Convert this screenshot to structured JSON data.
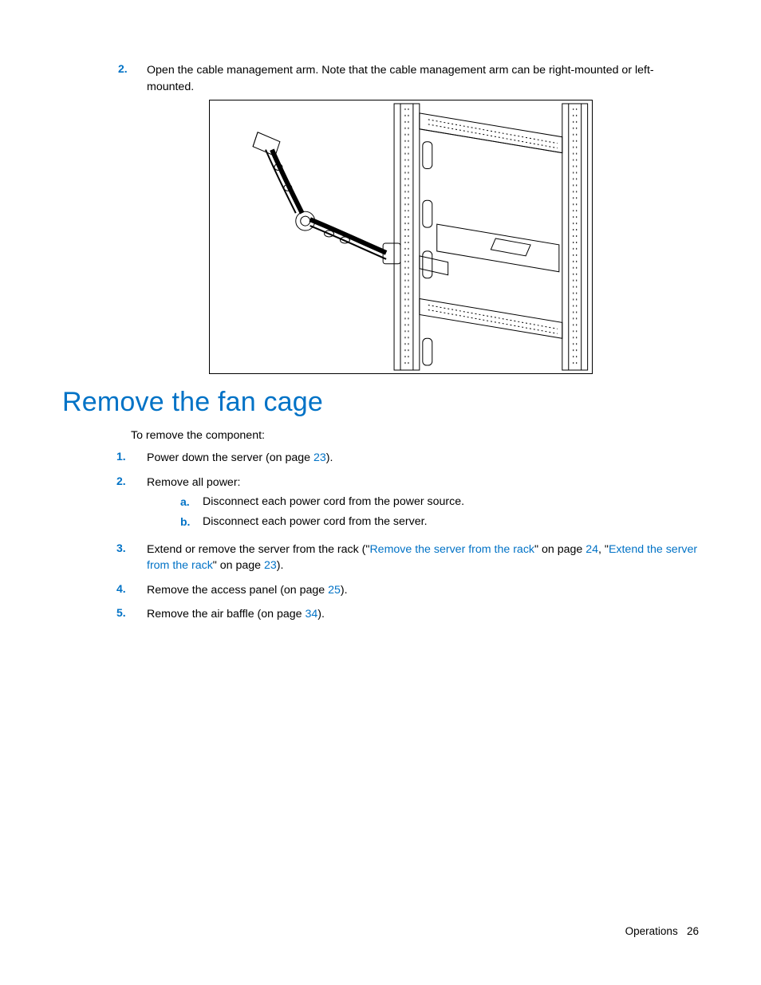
{
  "topStep": {
    "num": "2.",
    "text": "Open the cable management arm. Note that the cable management arm can be right-mounted or left-mounted."
  },
  "section": {
    "heading": "Remove the fan cage",
    "intro": "To remove the component:",
    "steps": [
      {
        "num": "1.",
        "pre": "Power down the server (on page ",
        "link1": "23",
        "post": ")."
      },
      {
        "num": "2.",
        "text": "Remove all power:",
        "sub": [
          {
            "letter": "a.",
            "text": "Disconnect each power cord from the power source."
          },
          {
            "letter": "b.",
            "text": "Disconnect each power cord from the server."
          }
        ]
      },
      {
        "num": "3.",
        "pre": "Extend or remove the server from the rack (\"",
        "link1": "Remove the server from the rack",
        "mid1": "\" on page ",
        "link2": "24",
        "mid2": ", \"",
        "link3": "Extend the server from the rack",
        "mid3": "\" on page ",
        "link4": "23",
        "post": ")."
      },
      {
        "num": "4.",
        "pre": "Remove the access panel (on page ",
        "link1": "25",
        "post": ")."
      },
      {
        "num": "5.",
        "pre": "Remove the air baffle (on page ",
        "link1": "34",
        "post": ")."
      }
    ]
  },
  "footer": {
    "section": "Operations",
    "page": "26"
  }
}
